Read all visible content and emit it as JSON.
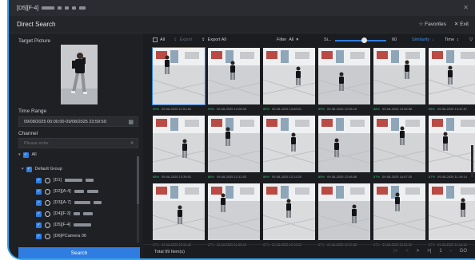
{
  "window": {
    "title": "[D5][F-4]",
    "close_icon": "close-icon"
  },
  "header": {
    "title": "Direct Search",
    "favorites_label": "Favorites",
    "exit_label": "Exit"
  },
  "left_panel": {
    "target_label": "Target Picture",
    "time_range_label": "Time Range",
    "time_range_value": "09/08/2025 00:00:00-09/08/2025 23:59:59",
    "channel_label": "Channel",
    "channel_search_placeholder": "Please enter",
    "tree": [
      {
        "label": "All",
        "level": 0
      },
      {
        "label": "Default Group",
        "level": 1
      },
      {
        "label": "[D1]",
        "level": 2
      },
      {
        "label": "[D2][A-4]",
        "level": 2
      },
      {
        "label": "[D3][A-7]",
        "level": 2
      },
      {
        "label": "[D4][F-3]",
        "level": 2
      },
      {
        "label": "[D5][F-4]",
        "level": 2
      },
      {
        "label": "[D6]PCamera 06",
        "level": 2
      }
    ],
    "search_label": "Search"
  },
  "toolbar": {
    "all_label": "All",
    "export_label": "Export",
    "export_all_label": "Export All",
    "filter_label": "Filter",
    "filter_value": "All",
    "similarity_short": "Si...",
    "similarity_value": "60",
    "sort_similarity_label": "Similarity",
    "sort_time_label": "Time"
  },
  "results": [
    {
      "similarity": "90%",
      "time": "09-08-2025 11:51:46"
    },
    {
      "similarity": "90%",
      "time": "09-08-2025 10:08:33"
    },
    {
      "similarity": "89%",
      "time": "09-08-2025 13:08:01"
    },
    {
      "similarity": "89%",
      "time": "09-08-2025 10:36:15"
    },
    {
      "similarity": "88%",
      "time": "09-08-2025 13:36:58"
    },
    {
      "similarity": "88%",
      "time": "09-08-2025 13:42:57"
    },
    {
      "similarity": "88%",
      "time": "09-08-2025 13:39:01"
    },
    {
      "similarity": "88%",
      "time": "09-08-2025 12:12:03"
    },
    {
      "similarity": "88%",
      "time": "09-08-2025 12:13:20"
    },
    {
      "similarity": "88%",
      "time": "09-08-2025 12:08:38"
    },
    {
      "similarity": "87%",
      "time": "09-08-2025 14:07:20"
    },
    {
      "similarity": "87%",
      "time": "09-08-2025 11:19:14"
    },
    {
      "similarity": "87%",
      "time": "09-08-2025 12:06:40"
    },
    {
      "similarity": "87%",
      "time": "09-08-2025 11:55:42"
    },
    {
      "similarity": "87%",
      "time": "09-08-2025 12:13:09"
    },
    {
      "similarity": "87%",
      "time": "09-08-2025 12:09:38"
    },
    {
      "similarity": "87%",
      "time": "09-08-2025 10:56:30"
    },
    {
      "similarity": "87%",
      "time": "09-08-2025 11:14:18"
    }
  ],
  "footer": {
    "total_label": "Total 99 Item(s)",
    "page_current": "1",
    "go_label": "GO"
  }
}
